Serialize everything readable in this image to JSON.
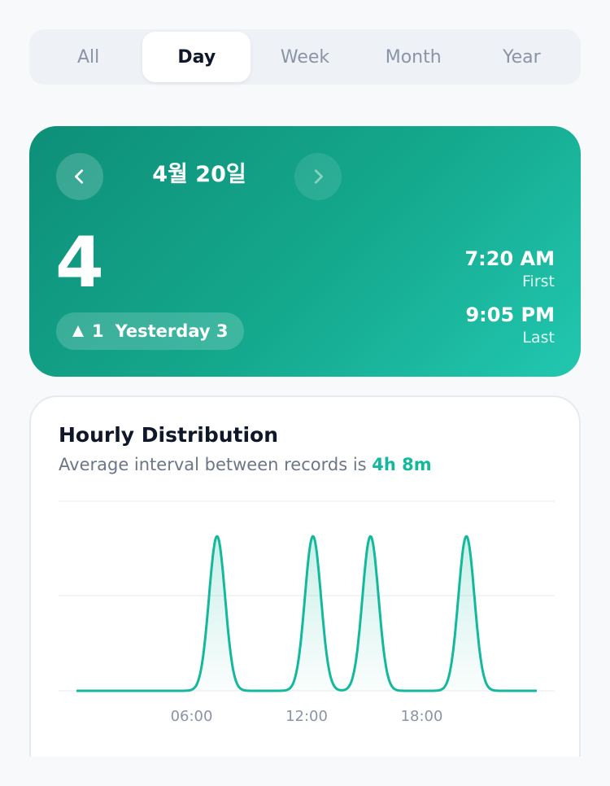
{
  "tabs": [
    {
      "label": "All",
      "active": false
    },
    {
      "label": "Day",
      "active": true
    },
    {
      "label": "Week",
      "active": false
    },
    {
      "label": "Month",
      "active": false
    },
    {
      "label": "Year",
      "active": false
    }
  ],
  "hero": {
    "date": "4월 20일",
    "count": "4",
    "delta": "1",
    "yesterday_label": "Yesterday 3",
    "first_time": "7:20 AM",
    "first_label": "First",
    "last_time": "9:05 PM",
    "last_label": "Last"
  },
  "chart_card": {
    "title": "Hourly Distribution",
    "subtitle_prefix": "Average interval between records is",
    "subtitle_value": "4h 8m"
  },
  "icons": {
    "prev": "chevron-left-icon",
    "next": "chevron-right-icon",
    "delta": "triangle-up-icon"
  },
  "colors": {
    "accent": "#14b89c",
    "hero_start": "#0e8f78",
    "hero_end": "#22c7b0"
  },
  "chart_data": {
    "type": "area",
    "title": "",
    "xlabel": "",
    "ylabel": "",
    "x_ticks": [
      "06:00",
      "12:00",
      "18:00"
    ],
    "xlim": [
      0,
      24
    ],
    "ylim": [
      0,
      1.2
    ],
    "peaks": [
      {
        "hour": 7.33,
        "value": 1
      },
      {
        "hour": 12.33,
        "value": 1
      },
      {
        "hour": 15.33,
        "value": 1
      },
      {
        "hour": 20.33,
        "value": 1
      }
    ],
    "grid": true
  }
}
